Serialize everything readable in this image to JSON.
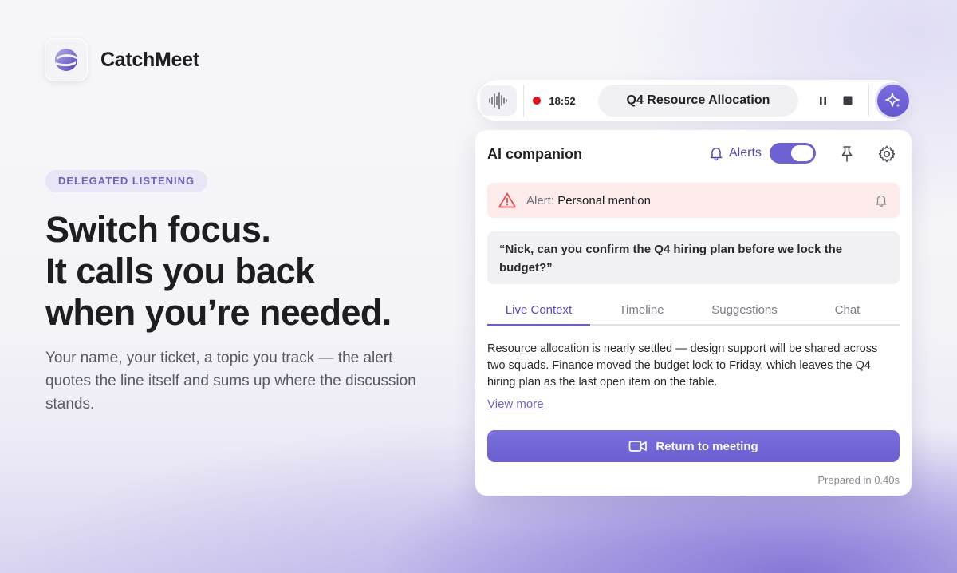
{
  "brand": {
    "name": "CatchMeet"
  },
  "hero": {
    "badge": "DELEGATED LISTENING",
    "headline": [
      "Switch focus.",
      "It calls you back",
      "when you’re needed."
    ],
    "subcopy": "Your name, your ticket, a topic you track — the alert quotes the line itself and sums up where the discussion stands."
  },
  "recording_bar": {
    "timer": "18:52",
    "meeting_title": "Q4 Resource Allocation",
    "recording": true
  },
  "companion": {
    "title": "AI companion",
    "alerts_label": "Alerts",
    "alerts_enabled": true,
    "alert": {
      "prefix": "Alert:",
      "text": "Personal mention"
    },
    "quote": "“Nick, can you confirm the Q4 hiring plan before we lock the budget?”",
    "tabs": [
      {
        "label": "Live Context",
        "active": true
      },
      {
        "label": "Timeline",
        "active": false
      },
      {
        "label": "Suggestions",
        "active": false
      },
      {
        "label": "Chat",
        "active": false
      }
    ],
    "context": "Resource allocation is nearly settled — design support will be shared across two squads. Finance moved the budget lock to Friday, which leaves the Q4 hiring plan as the last open item on the table.",
    "view_more": "View more",
    "return_button": "Return to meeting",
    "prepared": "Prepared in 0.40s"
  },
  "colors": {
    "accent": "#6e62d3",
    "recording_dot": "#e0161b",
    "alert_bg": "#fdeceb",
    "alert_icon": "#e5484d"
  },
  "icons": [
    "catchmeet-logo",
    "waveform-icon",
    "pause-icon",
    "stop-icon",
    "sparkle-icon",
    "bell-icon",
    "pin-icon",
    "gear-icon",
    "warning-icon",
    "video-camera-icon"
  ]
}
